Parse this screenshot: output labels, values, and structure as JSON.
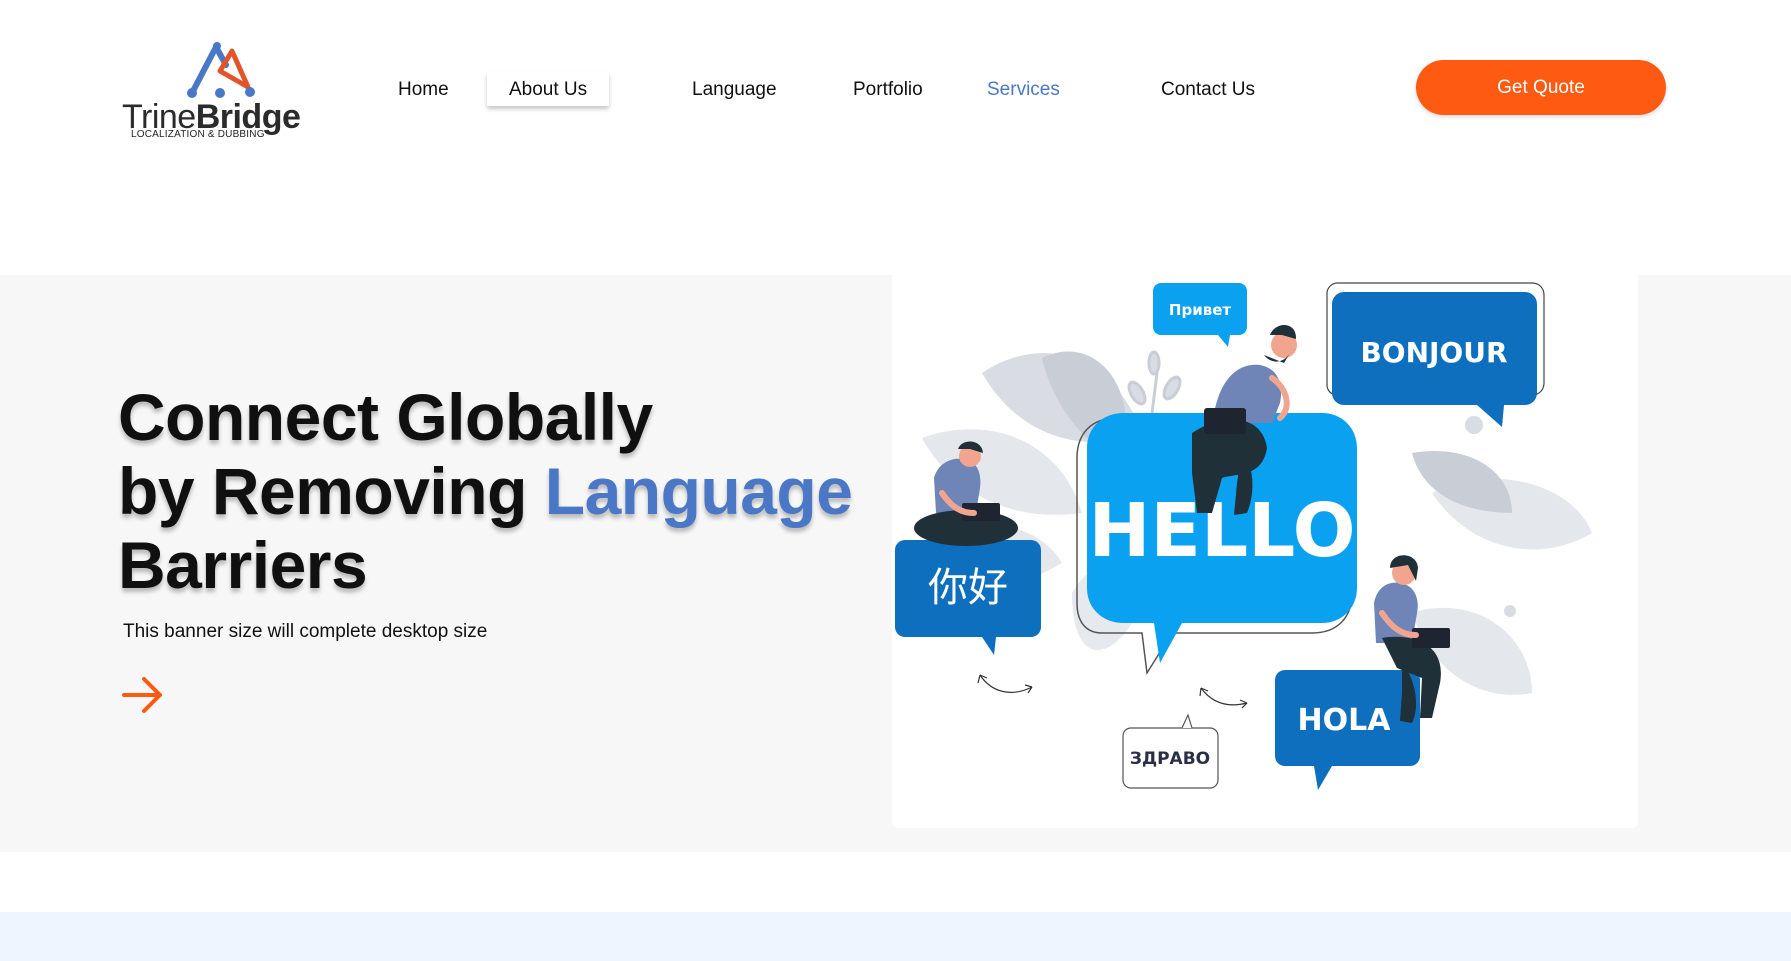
{
  "brand": {
    "name_light": "Trine",
    "name_bold": "Bridge",
    "tagline": "LOCALIZATION & DUBBING",
    "colors": {
      "mark_blue": "#4a78c6",
      "mark_orange": "#e2542a",
      "text": "#2b2b2b"
    }
  },
  "nav": {
    "items": [
      {
        "label": "Home"
      },
      {
        "label": "About Us"
      },
      {
        "label": "Language"
      },
      {
        "label": "Portfolio"
      },
      {
        "label": "Services"
      },
      {
        "label": "Contact Us"
      }
    ],
    "highlighted_item": "About Us",
    "active_item": "Services",
    "cta_label": "Get Quote"
  },
  "hero": {
    "headline_line1": "Connect Globally",
    "headline_line2_prefix": "by Removing ",
    "headline_line2_accent": "Language",
    "headline_line3": "Barriers",
    "subtext": "This banner size will complete desktop size",
    "arrow_icon": "arrow-right-icon"
  },
  "illustration": {
    "bubbles": {
      "hello": "HELLO",
      "bonjour": "BONJOUR",
      "privet": "Привет",
      "nihao": "你好",
      "hola": "HOLA",
      "zdravo": "ЗДРАВО"
    }
  },
  "colors": {
    "accent_blue": "#4a78c6",
    "cta_orange": "#ff5a12",
    "hero_bg": "#f7f7f7",
    "bubble_light_blue": "#0aa2f0",
    "bubble_dark_blue": "#0f6fbf",
    "bottom_strip": "#eef5fe"
  }
}
